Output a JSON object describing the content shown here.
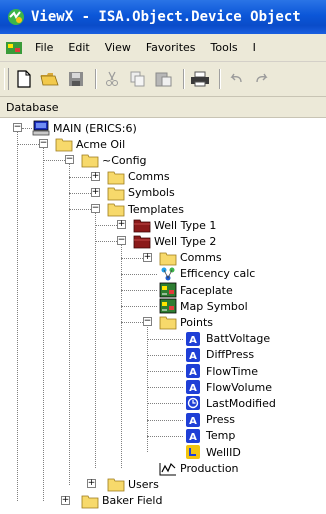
{
  "window": {
    "title": "ViewX - ISA.Object.Device Object"
  },
  "menu": {
    "items": [
      {
        "label": "File"
      },
      {
        "label": "Edit"
      },
      {
        "label": "View"
      },
      {
        "label": "Favorites"
      },
      {
        "label": "Tools"
      },
      {
        "label": "I"
      }
    ]
  },
  "toolbar": {
    "buttons": [
      "new-icon",
      "open-folder-icon",
      "save-icon",
      "cut-icon",
      "copy-icon",
      "paste-icon",
      "print-icon",
      "undo-icon",
      "redo-icon"
    ]
  },
  "panel": {
    "header": "Database"
  },
  "tree": {
    "nodes": [
      {
        "label": "MAIN (ERICS:6)",
        "icon": "server-icon"
      },
      {
        "label": "Acme Oil",
        "icon": "folder-icon"
      },
      {
        "label": "~Config",
        "icon": "folder-icon"
      },
      {
        "label": "Comms",
        "icon": "folder-icon"
      },
      {
        "label": "Symbols",
        "icon": "folder-icon"
      },
      {
        "label": "Templates",
        "icon": "folder-icon"
      },
      {
        "label": "Well Type 1",
        "icon": "template-folder-icon"
      },
      {
        "label": "Well Type 2",
        "icon": "template-folder-icon"
      },
      {
        "label": "Comms",
        "icon": "folder-icon"
      },
      {
        "label": "Efficency calc",
        "icon": "logic-icon"
      },
      {
        "label": "Faceplate",
        "icon": "mimic-icon"
      },
      {
        "label": "Map Symbol",
        "icon": "mimic-icon"
      },
      {
        "label": "Points",
        "icon": "folder-icon"
      },
      {
        "label": "BattVoltage",
        "icon": "analog-point-icon"
      },
      {
        "label": "DiffPress",
        "icon": "analog-point-icon"
      },
      {
        "label": "FlowTime",
        "icon": "analog-point-icon"
      },
      {
        "label": "FlowVolume",
        "icon": "analog-point-icon"
      },
      {
        "label": "LastModified",
        "icon": "time-point-icon"
      },
      {
        "label": "Press",
        "icon": "analog-point-icon"
      },
      {
        "label": "Temp",
        "icon": "analog-point-icon"
      },
      {
        "label": "WellID",
        "icon": "string-point-icon"
      },
      {
        "label": "Production",
        "icon": "trend-icon"
      },
      {
        "label": "Users",
        "icon": "folder-icon"
      },
      {
        "label": "Baker Field",
        "icon": "folder-icon"
      }
    ]
  },
  "colors": {
    "titlebar": "#0b56d8",
    "folder": "#f7d96b",
    "template_folder": "#8b1a1a",
    "analog_point": "#1f3fd6",
    "string_point": "#f2c40f"
  }
}
